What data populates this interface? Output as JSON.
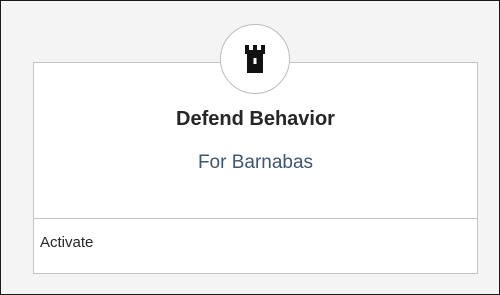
{
  "card": {
    "icon": "castle-tower-icon",
    "title": "Defend Behavior",
    "subtitle": "For Barnabas",
    "action_label": "Activate"
  },
  "colors": {
    "subtitle": "#3e5672",
    "title": "#262626",
    "card_border": "#c4c4c4",
    "icon": "#111111"
  }
}
